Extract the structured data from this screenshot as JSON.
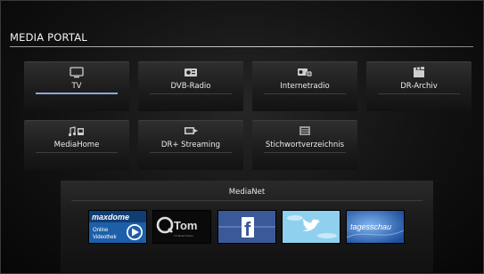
{
  "portal": {
    "title": "MEDIA PORTAL"
  },
  "tiles": [
    {
      "label": "TV",
      "icon": "tv-icon",
      "selected": true
    },
    {
      "label": "DVB-Radio",
      "icon": "radio-icon"
    },
    {
      "label": "Internetradio",
      "icon": "internet-radio-icon"
    },
    {
      "label": "DR-Archiv",
      "icon": "clapperboard-icon"
    },
    {
      "label": "MediaHome",
      "icon": "media-home-icon"
    },
    {
      "label": "DR+ Streaming",
      "icon": "streaming-icon"
    },
    {
      "label": "Stichwortverzeichnis",
      "icon": "index-icon"
    }
  ],
  "medianet": {
    "title": "MediaNet",
    "apps": [
      {
        "name": "maxdome",
        "line1": "maxdome",
        "line2": "Online",
        "line3": "Videothek"
      },
      {
        "name": "qtom",
        "text": "Tom",
        "sub": "TV Music Power"
      },
      {
        "name": "facebook",
        "text": "f"
      },
      {
        "name": "twitter"
      },
      {
        "name": "tagesschau",
        "text": "tagesschau"
      }
    ]
  },
  "colors": {
    "selection": "#8ea7d6",
    "facebook": "#3b5998",
    "twitter": "#8fd0ee",
    "tagesschau": "#3f7fd6"
  }
}
